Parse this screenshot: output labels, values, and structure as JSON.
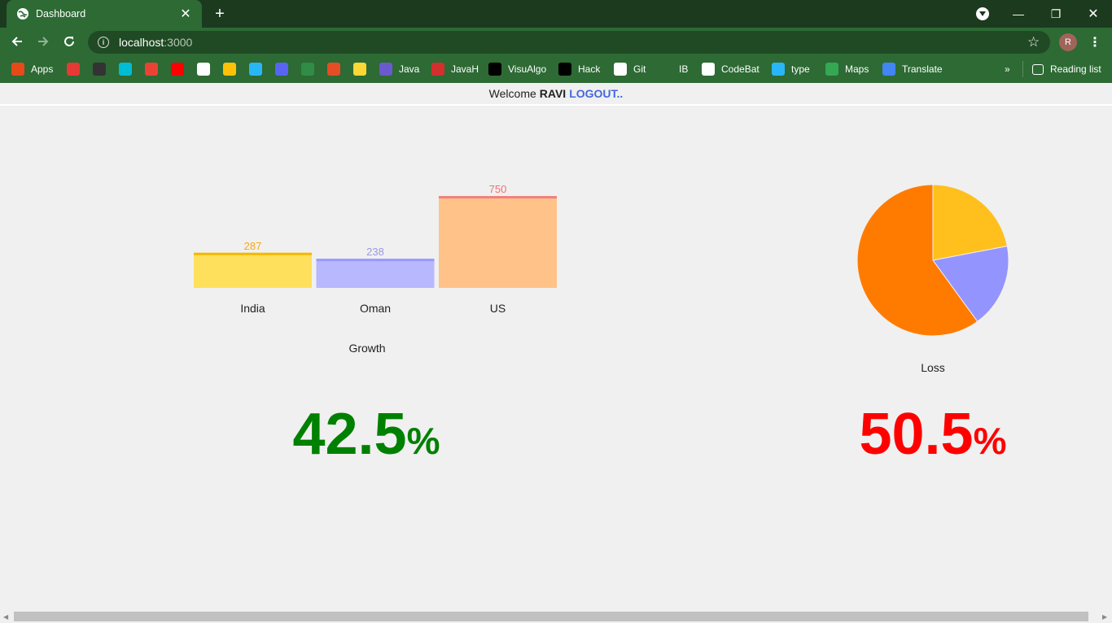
{
  "browser": {
    "tab_title": "Dashboard",
    "url_host": "localhost",
    "url_port": ":3000",
    "profile_initial": "R",
    "bookmarks": [
      {
        "label": "Apps",
        "icon": "apps-grid-icon",
        "color": "#e64a19"
      },
      {
        "label": "",
        "icon": "office-icon",
        "color": "#e53935"
      },
      {
        "label": "",
        "icon": "speedometer-icon",
        "color": "#333333"
      },
      {
        "label": "",
        "icon": "tp-icon",
        "color": "#00bcd4"
      },
      {
        "label": "",
        "icon": "gmail-icon",
        "color": "#ea4335"
      },
      {
        "label": "",
        "icon": "youtube-icon",
        "color": "#ff0000"
      },
      {
        "label": "",
        "icon": "amazon-icon",
        "color": "#ffffff"
      },
      {
        "label": "",
        "icon": "flipkart-icon",
        "color": "#ffc107"
      },
      {
        "label": "",
        "icon": "arrow-icon",
        "color": "#29b6f6"
      },
      {
        "label": "",
        "icon": "discord-icon",
        "color": "#5865f2"
      },
      {
        "label": "",
        "icon": "gfg-icon",
        "color": "#2f8d46"
      },
      {
        "label": "",
        "icon": "code-icon",
        "color": "#e44d26"
      },
      {
        "label": "",
        "icon": "p-icon",
        "color": "#fdd835"
      },
      {
        "label": "Java",
        "icon": "bolt-icon",
        "color": "#6a5acd"
      },
      {
        "label": "JavaH",
        "icon": "javah-icon",
        "color": "#d32f2f"
      },
      {
        "label": "VisuAlgo",
        "icon": "visualgo-icon",
        "color": "#000000"
      },
      {
        "label": "Hack",
        "icon": "hackerrank-icon",
        "color": "#000000"
      },
      {
        "label": "Git",
        "icon": "github-icon",
        "color": "#ffffff"
      },
      {
        "label": "IB",
        "icon": "ib-icon",
        "color": "#2d6a34"
      },
      {
        "label": "CodeBat",
        "icon": "globe-icon",
        "color": "#ffffff"
      },
      {
        "label": "type",
        "icon": "type-icon",
        "color": "#29b6f6"
      },
      {
        "label": "Maps",
        "icon": "maps-icon",
        "color": "#34a853"
      },
      {
        "label": "Translate",
        "icon": "translate-icon",
        "color": "#4285f4"
      }
    ],
    "more_label": "»",
    "reading_list_label": "Reading list"
  },
  "header": {
    "welcome_text": "Welcome",
    "username": "RAVI",
    "logout_label": "LOGOUT.."
  },
  "growth": {
    "caption": "Growth",
    "percent_value": "42.5",
    "percent_sign": "%",
    "color": "#008000"
  },
  "loss": {
    "caption": "Loss",
    "percent_value": "50.5",
    "percent_sign": "%",
    "color": "#ff0000"
  },
  "chart_data": [
    {
      "type": "bar",
      "categories": [
        "India",
        "Oman",
        "US"
      ],
      "values": [
        287,
        238,
        750
      ],
      "fill_colors": [
        "#ffe05c",
        "#b8b8ff",
        "#ffc288"
      ],
      "top_colors": [
        "#f4b800",
        "#9a9aff",
        "#f08080"
      ],
      "label_colors": [
        "#f4a81a",
        "#9a9ae6",
        "#f07070"
      ],
      "xlabel": "Growth",
      "ylim": [
        0,
        750
      ],
      "grid": false
    },
    {
      "type": "pie",
      "values": [
        0.22,
        0.18,
        0.6
      ],
      "colors": [
        "#ffc01e",
        "#9494ff",
        "#ff7b00"
      ],
      "xlabel": "Loss"
    }
  ]
}
